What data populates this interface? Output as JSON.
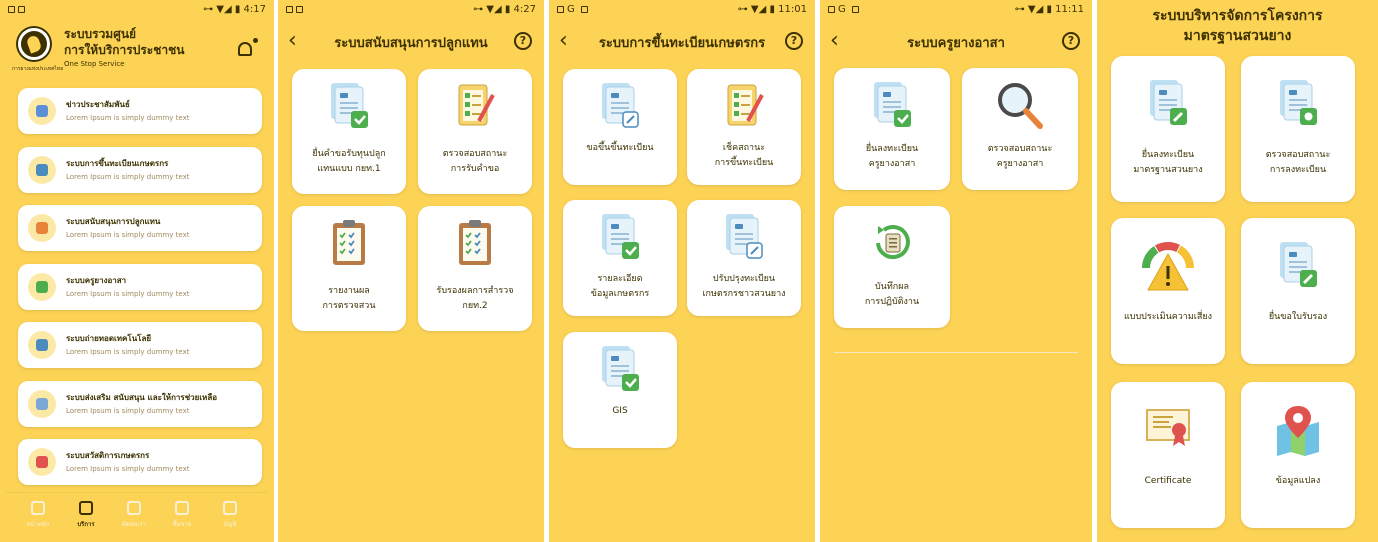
{
  "colors": {
    "background": "#fdd356",
    "card": "#ffffff",
    "text": "#3d3100",
    "check": "#4cae4c",
    "pencil": "#e0524e"
  },
  "screen1": {
    "time": "4:17",
    "app_title_line1": "ระบบรวมศูนย์",
    "app_title_line2": "การให้บริการประชาชน",
    "app_subtitle": "One Stop Service",
    "logo_caption": "การยางแห่งประเทศไทย",
    "menu": [
      {
        "title": "ข่าวประชาสัมพันธ์",
        "subtitle": "Lorem Ipsum is simply dummy text",
        "icon": "news-icon"
      },
      {
        "title": "ระบบการขึ้นทะเบียนเกษตรกร",
        "subtitle": "Lorem Ipsum is simply dummy text",
        "icon": "farmer-icon"
      },
      {
        "title": "ระบบสนับสนุนการปลูกแทน",
        "subtitle": "Lorem Ipsum is simply dummy text",
        "icon": "plant-icon"
      },
      {
        "title": "ระบบครูยางอาสา",
        "subtitle": "Lorem Ipsum is simply dummy text",
        "icon": "sprout-icon"
      },
      {
        "title": "ระบบถ่ายทอดเทคโนโลยี",
        "subtitle": "Lorem Ipsum is simply dummy text",
        "icon": "tech-icon"
      },
      {
        "title": "ระบบส่งเสริม สนับสนุน และให้การช่วยเหลือ",
        "subtitle": "Lorem Ipsum is simply dummy text",
        "icon": "support-icon"
      },
      {
        "title": "ระบบสวัสดิการเกษตรกร",
        "subtitle": "Lorem Ipsum is simply dummy text",
        "icon": "welfare-icon"
      }
    ],
    "nav": [
      {
        "label": "หน้าหลัก",
        "icon": "home-icon"
      },
      {
        "label": "บริการ",
        "icon": "service-icon",
        "active": true
      },
      {
        "label": "ติดต่อเรา",
        "icon": "phone-icon"
      },
      {
        "label": "ซื้อขาย",
        "icon": "cart-icon"
      },
      {
        "label": "บัญชี",
        "icon": "user-icon"
      }
    ]
  },
  "screen2": {
    "time": "4:27",
    "title": "ระบบสนับสนุนการปลูกแทน",
    "tiles": [
      {
        "line1": "ยื่นคำขอรับทุนปลูก",
        "line2": "แทนแบบ กยท.1",
        "icon": "document-check-icon"
      },
      {
        "line1": "ตรวจสอบสถานะ",
        "line2": "การรับคำขอ",
        "icon": "checklist-pencil-icon"
      },
      {
        "line1": "รายงานผล",
        "line2": "การตรวจสวน",
        "icon": "clipboard-icon"
      },
      {
        "line1": "รับรองผลการสำรวจ",
        "line2": "กยท.2",
        "icon": "clipboard-icon"
      }
    ]
  },
  "screen3": {
    "time": "11:01",
    "title": "ระบบการขึ้นทะเบียนเกษตรกร",
    "tiles": [
      {
        "line1": "ขอขึ้นขึ้นทะเบียน",
        "line2": "",
        "icon": "document-edit-icon"
      },
      {
        "line1": "เช็คสถานะ",
        "line2": "การขึ้นทะเบียน",
        "icon": "checklist-pencil-icon"
      },
      {
        "line1": "รายละเอียด",
        "line2": "ข้อมูลเกษตรกร",
        "icon": "document-check-icon"
      },
      {
        "line1": "ปรับปรุงทะเบียน",
        "line2": "เกษตรกรชาวสวนยาง",
        "icon": "document-edit-icon"
      },
      {
        "line1": "GIS",
        "line2": "",
        "icon": "document-check-icon"
      }
    ]
  },
  "screen4": {
    "time": "11:11",
    "title": "ระบบครูยางอาสา",
    "tiles": [
      {
        "line1": "ยื่นลงทะเบียน",
        "line2": "ครูยางอาสา",
        "icon": "document-check-icon"
      },
      {
        "line1": "ตรวจสอบสถานะ",
        "line2": "ครูยางอาสา",
        "icon": "magnifier-icon"
      },
      {
        "line1": "บันทึกผล",
        "line2": "การปฏิบัติงาน",
        "icon": "refresh-document-icon"
      }
    ]
  },
  "screen5": {
    "title_line1": "ระบบบริหารจัดการโครงการ",
    "title_line2": "มาตรฐานสวนยาง",
    "tiles": [
      {
        "line1": "ยื่นลงทะเบียน",
        "line2": "มาตรฐานสวนยาง",
        "icon": "document-pencil-icon"
      },
      {
        "line1": "ตรวจสอบสถานะ",
        "line2": "การลงทะเบียน",
        "icon": "document-search-icon"
      },
      {
        "line1": "แบบประเมินความเสี่ยง",
        "line2": "",
        "icon": "warning-gauge-icon"
      },
      {
        "line1": "ยื่นขอใบรับรอง",
        "line2": "",
        "icon": "document-pencil-icon"
      },
      {
        "line1": "Certificate",
        "line2": "",
        "icon": "certificate-icon"
      },
      {
        "line1": "ข้อมูลแปลง",
        "line2": "",
        "icon": "map-pin-icon"
      }
    ]
  }
}
